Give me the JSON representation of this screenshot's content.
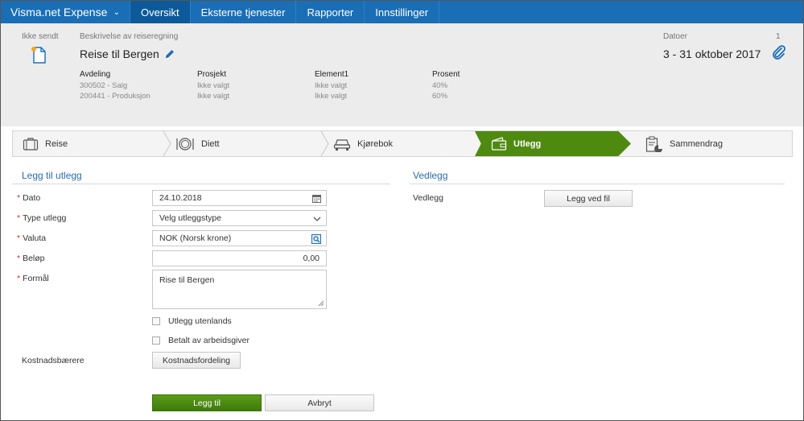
{
  "nav": {
    "brand": "Visma.net Expense",
    "tabs": [
      {
        "label": "Oversikt",
        "active": true
      },
      {
        "label": "Eksterne tjenester",
        "active": false
      },
      {
        "label": "Rapporter",
        "active": false
      },
      {
        "label": "Innstillinger",
        "active": false
      }
    ]
  },
  "header": {
    "status": "Ikke sendt",
    "desc_label": "Beskrivelse av reiseregning",
    "title": "Reise til Bergen",
    "dates_label": "Datoer",
    "count": "1",
    "dates": "3 - 31 oktober 2017",
    "columns": [
      {
        "header": "Avdeling",
        "values": [
          "300502 - Salg",
          "200441 - Produksjon"
        ]
      },
      {
        "header": "Prosjekt",
        "values": [
          "Ikke valgt",
          "Ikke valgt"
        ]
      },
      {
        "header": "Element1",
        "values": [
          "Ikke valgt",
          "Ikke valgt"
        ]
      },
      {
        "header": "Prosent",
        "values": [
          "40%",
          "60%"
        ]
      }
    ]
  },
  "steps": [
    {
      "label": "Reise"
    },
    {
      "label": "Diett"
    },
    {
      "label": "Kjørebok"
    },
    {
      "label": "Utlegg"
    },
    {
      "label": "Sammendrag"
    }
  ],
  "form": {
    "title": "Legg til utlegg",
    "date_label": "Dato",
    "date_value": "24.10.2018",
    "type_label": "Type utlegg",
    "type_value": "Velg utleggstype",
    "currency_label": "Valuta",
    "currency_value": "NOK (Norsk krone)",
    "amount_label": "Beløp",
    "amount_value": "0,00",
    "purpose_label": "Formål",
    "purpose_value": "Rise til Bergen",
    "abroad_label": "Utlegg utenlands",
    "employer_paid_label": "Betalt av arbeidsgiver",
    "cost_bearers_label": "Kostnadsbærere",
    "cost_distribution_button": "Kostnadsfordeling",
    "add_button": "Legg til",
    "cancel_button": "Avbryt"
  },
  "attachments": {
    "title": "Vedlegg",
    "label": "Vedlegg",
    "button": "Legg ved fil"
  },
  "colors": {
    "nav_bg": "#1a6eb5",
    "nav_active": "#0d5a9a",
    "step_active": "#4f8a10",
    "primary_button": "#4f8a10",
    "link_blue": "#2a6cb0",
    "required": "#c0392b"
  }
}
